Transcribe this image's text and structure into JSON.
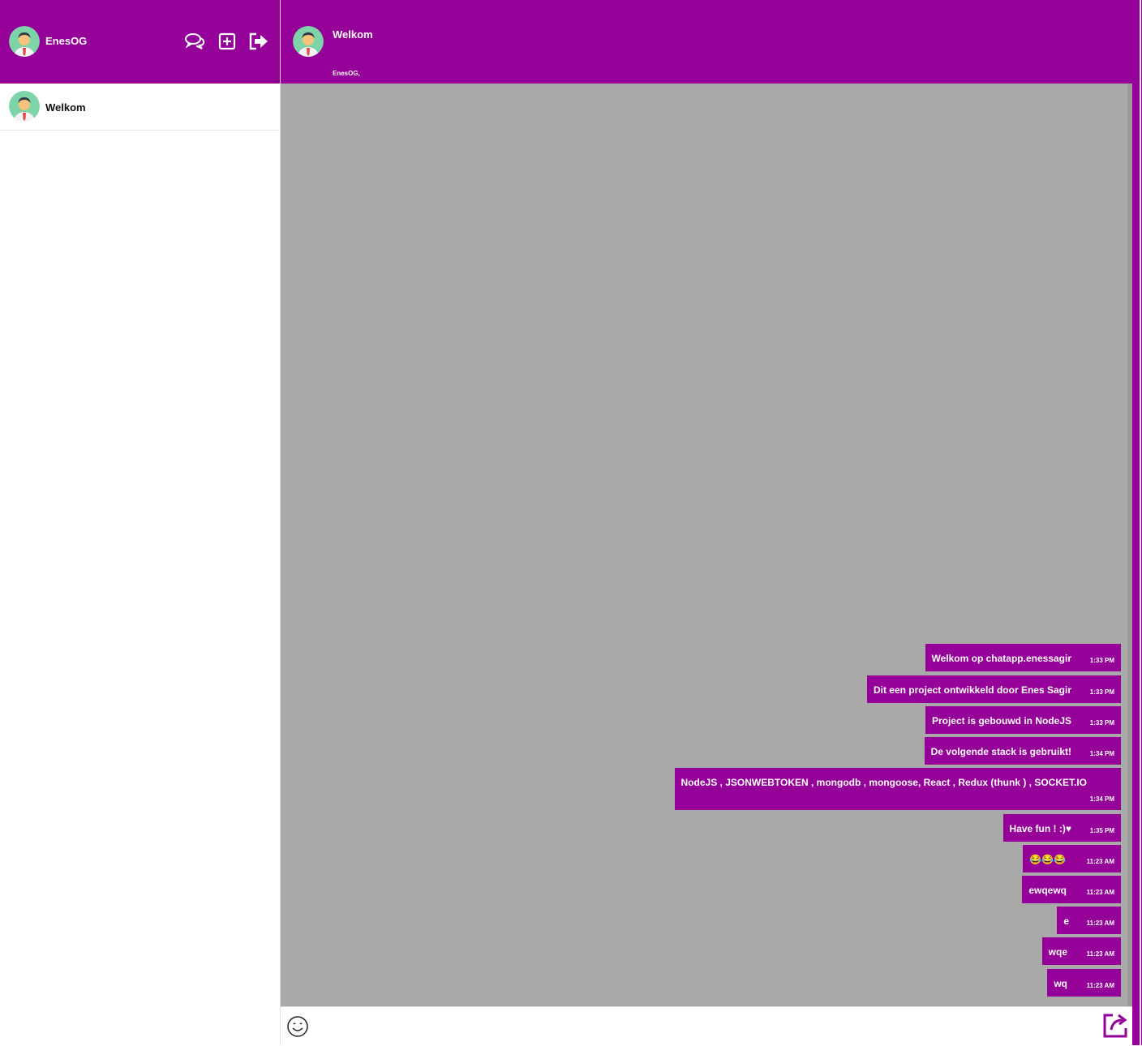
{
  "sidebar": {
    "username": "EnesOG",
    "icons": [
      "chats-icon",
      "new-chat-icon",
      "logout-icon"
    ],
    "conversations": [
      {
        "label": "Welkom"
      }
    ]
  },
  "chat": {
    "title": "Welkom",
    "members": "EnesOG,",
    "messages": [
      {
        "text": "Welkom op chatapp.enessagir",
        "time": "1:33 PM"
      },
      {
        "text": "Dit een project ontwikkeld door Enes Sagir",
        "time": "1:33 PM"
      },
      {
        "text": "Project is gebouwd in NodeJS",
        "time": "1:33 PM"
      },
      {
        "text": "De volgende stack is gebruikt!",
        "time": "1:34 PM"
      },
      {
        "text": "NodeJS , JSONWEBTOKEN , mongodb , mongoose, React , Redux (thunk ) , SOCKET.IO",
        "time": "1:34 PM"
      },
      {
        "text": "Have fun ! :)♥",
        "time": "1:35 PM"
      },
      {
        "text": "😂😂😂",
        "time": "11:23 AM"
      },
      {
        "text": "ewqewq",
        "time": "11:23 AM"
      },
      {
        "text": "e",
        "time": "11:23 AM"
      },
      {
        "text": "wqe",
        "time": "11:23 AM"
      },
      {
        "text": "wq",
        "time": "11:23 AM"
      }
    ]
  },
  "input": {
    "placeholder": "",
    "value": ""
  },
  "colors": {
    "accent": "#940098",
    "chat_bg": "#a9a9a9",
    "sidebar_bg": "#ffffff"
  }
}
